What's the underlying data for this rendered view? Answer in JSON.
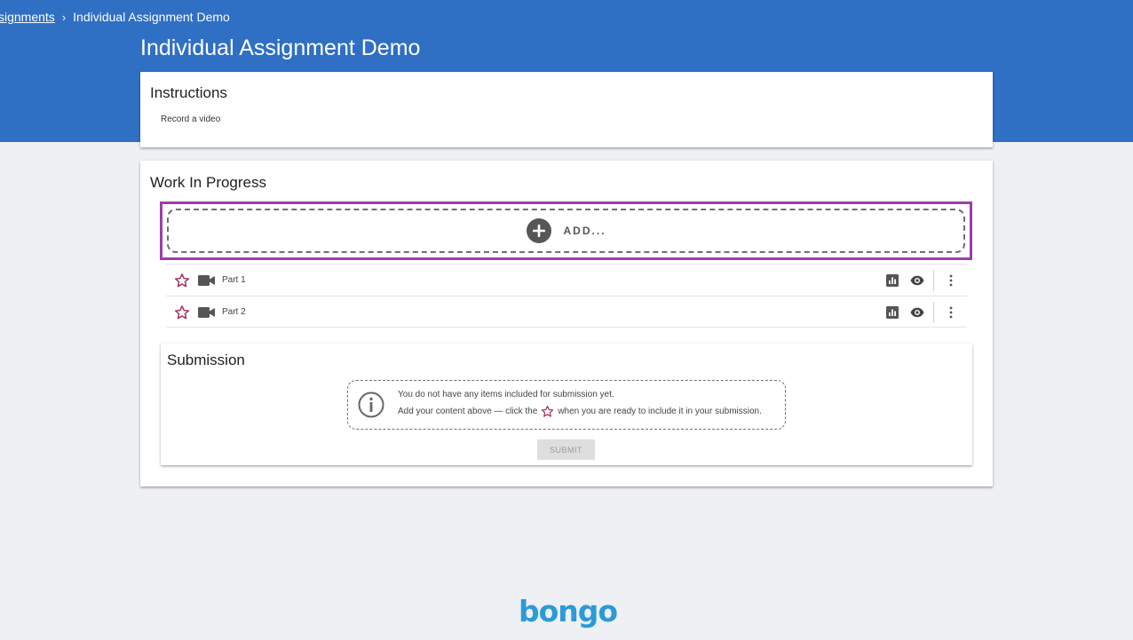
{
  "breadcrumb": {
    "parent": "signments",
    "separator": "›",
    "current": "Individual Assignment Demo"
  },
  "page": {
    "title": "Individual Assignment Demo"
  },
  "instructions": {
    "title": "Instructions",
    "text": "Record a video"
  },
  "work_in_progress": {
    "title": "Work In Progress",
    "add_label": "ADD...",
    "items": [
      {
        "label": "Part 1",
        "icon": "video-camera-icon"
      },
      {
        "label": "Part 2",
        "icon": "video-camera-icon"
      }
    ]
  },
  "submission": {
    "title": "Submission",
    "notice_line1": "You do not have any items included for submission yet.",
    "notice_line2_before": "Add your content above — click the",
    "notice_line2_after": "when you are ready to include it in your submission.",
    "submit_label": "SUBMIT"
  },
  "footer": {
    "logo": "bongo"
  },
  "colors": {
    "header": "#2f6fc4",
    "highlight": "#9b3fa8",
    "star": "#a3365c",
    "logo": "#2d9ad6",
    "background": "#eef0f3"
  }
}
